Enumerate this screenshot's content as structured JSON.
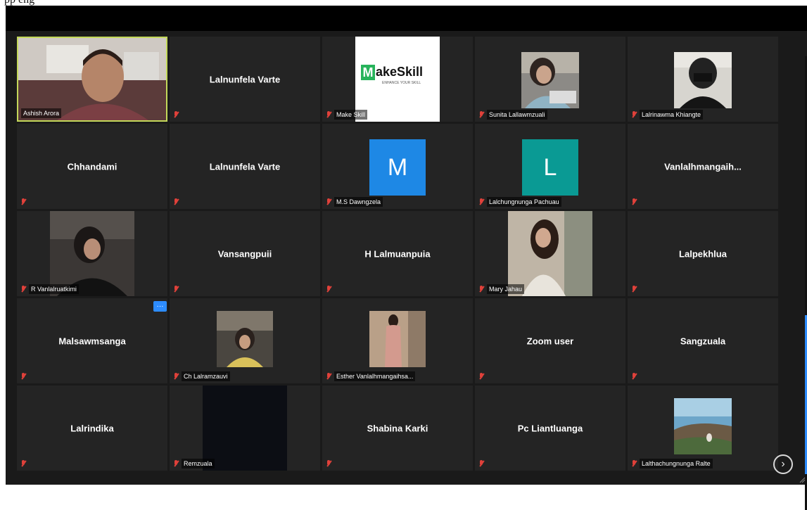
{
  "top_text": "pp     eng",
  "participants": [
    {
      "name": "Ashish Arora",
      "label": "Ashish Arora",
      "kind": "video",
      "active": true,
      "muted": false
    },
    {
      "name": "Lalnunfela Varte",
      "label": "",
      "kind": "name",
      "muted": true
    },
    {
      "name": "MakeSkill",
      "label": "Make Skill",
      "kind": "logo",
      "muted": true,
      "logo_text": "akeSkill",
      "logo_letter": "M",
      "logo_tagline": "ENHANCE YOUR SKILL"
    },
    {
      "name": "Sunita Lallawmzuali",
      "label": "Sunita Lallawmzuali",
      "kind": "photo",
      "muted": true
    },
    {
      "name": "Lalrinawma Khiangte",
      "label": "Lalrinawma Khiangte",
      "kind": "photo",
      "muted": true
    },
    {
      "name": "Chhandami",
      "label": "",
      "kind": "name",
      "muted": true
    },
    {
      "name": "Lalnunfela Varte",
      "label": "",
      "kind": "name",
      "muted": true
    },
    {
      "name": "M.S Dawngzela",
      "label": "M.S Dawngzela",
      "kind": "letter",
      "letter": "M",
      "muted": true
    },
    {
      "name": "Lalchungnunga Pachuau",
      "label": "Lalchungnunga Pachuau",
      "kind": "letter",
      "letter": "L",
      "muted": true
    },
    {
      "name": "Vanlalhmangaih...",
      "label": "",
      "kind": "name",
      "muted": true
    },
    {
      "name": "R Vanlalruatkimi",
      "label": "R Vanlalruatkimi",
      "kind": "photo",
      "muted": true
    },
    {
      "name": "Vansangpuii",
      "label": "",
      "kind": "name",
      "muted": true
    },
    {
      "name": "H Lalmuanpuia",
      "label": "",
      "kind": "name",
      "muted": true
    },
    {
      "name": "Mary Jahau",
      "label": "Mary Jahau",
      "kind": "photo",
      "muted": true
    },
    {
      "name": "Lalpekhlua",
      "label": "",
      "kind": "name",
      "muted": true
    },
    {
      "name": "Malsawmsanga",
      "label": "",
      "kind": "name",
      "muted": true
    },
    {
      "name": "Ch Lalramzauvi",
      "label": "Ch Lalramzauvi",
      "kind": "photo",
      "muted": true
    },
    {
      "name": "Esther Vanlalhmangaihsa...",
      "label": "Esther Vanlalhmangaihsa...",
      "kind": "photo",
      "muted": true
    },
    {
      "name": "Zoom user",
      "label": "",
      "kind": "name",
      "muted": true
    },
    {
      "name": "Sangzuala",
      "label": "",
      "kind": "name",
      "muted": true
    },
    {
      "name": "Lalrindika",
      "label": "",
      "kind": "name",
      "muted": true
    },
    {
      "name": "Remzuala",
      "label": "Remzuala",
      "kind": "black",
      "muted": true
    },
    {
      "name": "Shabina Karki",
      "label": "",
      "kind": "name",
      "muted": true
    },
    {
      "name": "Pc Liantluanga",
      "label": "",
      "kind": "name",
      "muted": true
    },
    {
      "name": "Lalthachungnunga Ralte",
      "label": "Lalthachungnunga Ralte",
      "kind": "photo",
      "muted": true
    }
  ],
  "controls": {
    "more_label": "···",
    "next_icon": "chevron-right-icon",
    "next_glyph": "›"
  },
  "colors": {
    "active_border": "#c3d85a",
    "mute_red": "#e0413a",
    "avatar_blue": "#1e88e5",
    "avatar_teal": "#0a9a94",
    "zoom_blue": "#2d8cff"
  }
}
